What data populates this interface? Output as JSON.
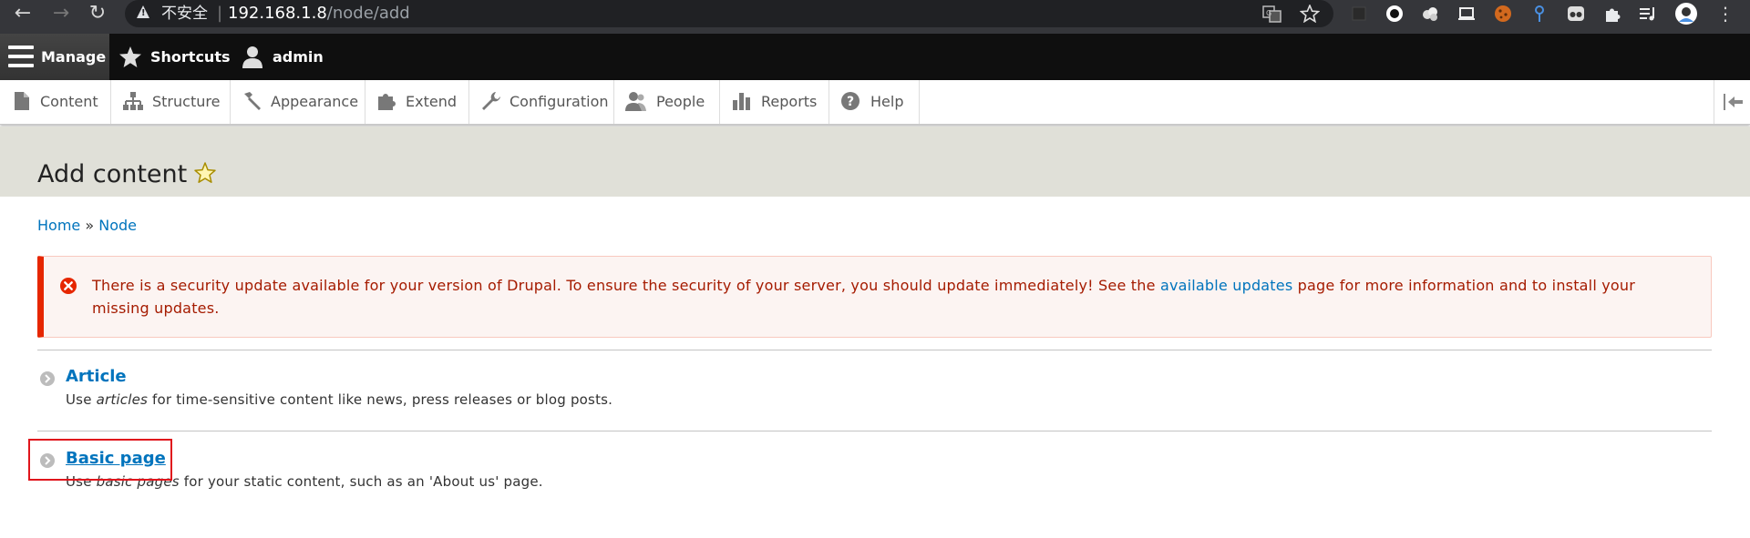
{
  "browser": {
    "insecure_label": "不安全",
    "url_host": "192.168.1.8",
    "url_path": "/node/add"
  },
  "toolbar": {
    "manage": "Manage",
    "shortcuts": "Shortcuts",
    "user": "admin"
  },
  "tray": {
    "items": [
      {
        "label": "Content",
        "icon": "document-icon"
      },
      {
        "label": "Structure",
        "icon": "sitemap-icon"
      },
      {
        "label": "Appearance",
        "icon": "paintbrush-icon"
      },
      {
        "label": "Extend",
        "icon": "puzzle-icon"
      },
      {
        "label": "Configuration",
        "icon": "wrench-icon"
      },
      {
        "label": "People",
        "icon": "people-icon"
      },
      {
        "label": "Reports",
        "icon": "bar-chart-icon"
      },
      {
        "label": "Help",
        "icon": "question-icon"
      }
    ]
  },
  "page": {
    "title": "Add content"
  },
  "breadcrumb": {
    "home": "Home",
    "separator": "»",
    "node": "Node"
  },
  "alert": {
    "text_before": "There is a security update available for your version of Drupal. To ensure the security of your server, you should update immediately! See the ",
    "link": "available updates",
    "text_after": " page for more information and to install your missing updates."
  },
  "content_types": [
    {
      "title": "Article",
      "desc_before": "Use ",
      "desc_em": "articles",
      "desc_after": " for time-sensitive content like news, press releases or blog posts."
    },
    {
      "title": "Basic page",
      "desc_before": "Use ",
      "desc_em": "basic pages",
      "desc_after": " for your static content, such as an 'About us' page."
    }
  ],
  "colors": {
    "link": "#0074bd",
    "alert_red": "#e62600",
    "toolbar_black": "#0f0f0f",
    "header_bg": "#e0e0d8"
  }
}
